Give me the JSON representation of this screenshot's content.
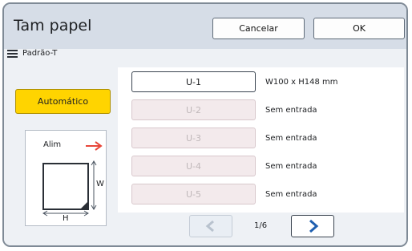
{
  "header": {
    "title": "Tam papel",
    "cancel_label": "Cancelar",
    "ok_label": "OK"
  },
  "subheader": {
    "label": "Padrão-T",
    "icon": "list-icon"
  },
  "auto_button": {
    "label": "Automático",
    "color": "#ffd400"
  },
  "diagram": {
    "feed_label": "Alim",
    "width_label": "W",
    "height_label": "H",
    "arrow_color": "#e8473a"
  },
  "trays": [
    {
      "label": "U-1",
      "info": "W100 x H148 mm",
      "enabled": true
    },
    {
      "label": "U-2",
      "info": "Sem entrada",
      "enabled": false
    },
    {
      "label": "U-3",
      "info": "Sem entrada",
      "enabled": false
    },
    {
      "label": "U-4",
      "info": "Sem entrada",
      "enabled": false
    },
    {
      "label": "U-5",
      "info": "Sem entrada",
      "enabled": false
    }
  ],
  "pagination": {
    "page_indicator": "1/6",
    "prev_icon": "chevron-left-icon",
    "next_icon": "chevron-right-icon"
  }
}
